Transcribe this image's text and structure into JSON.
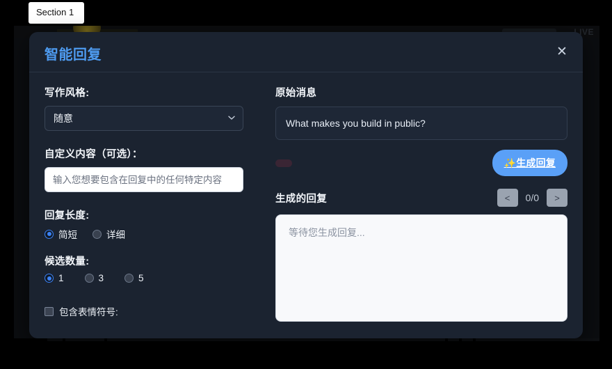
{
  "background": {
    "live_badge": "LIVE"
  },
  "tooltip": {
    "label": "Section 1"
  },
  "modal": {
    "title": "智能回复",
    "close_icon": "close-icon",
    "close_glyph": "✕",
    "accent_color": "#4e9bf0",
    "surface_color": "#1b2330",
    "left": {
      "style_label": "写作风格:",
      "style_selected": "随意",
      "style_options": [
        "随意"
      ],
      "custom_label": "自定义内容（可选）：",
      "custom_value": "",
      "custom_placeholder": "输入您想要包含在回复中的任何特定内容",
      "length_label": "回复长度:",
      "length_options": [
        {
          "label": "简短",
          "checked": true
        },
        {
          "label": "详细",
          "checked": false
        }
      ],
      "count_label": "候选数量:",
      "count_options": [
        {
          "label": "1",
          "checked": true
        },
        {
          "label": "3",
          "checked": false
        },
        {
          "label": "5",
          "checked": false
        }
      ],
      "emoji_label": "包含表情符号:",
      "emoji_checked": false
    },
    "right": {
      "original_heading": "原始消息",
      "original_message": "What makes you build in public?",
      "generate_button": "✨生成回复",
      "generate_button_color": "#5aa0f7",
      "generated_heading": "生成的回复",
      "prev_label": "<",
      "next_label": ">",
      "page_counter": "0/0",
      "output_placeholder": "等待您生成回复...",
      "output_value": ""
    }
  }
}
